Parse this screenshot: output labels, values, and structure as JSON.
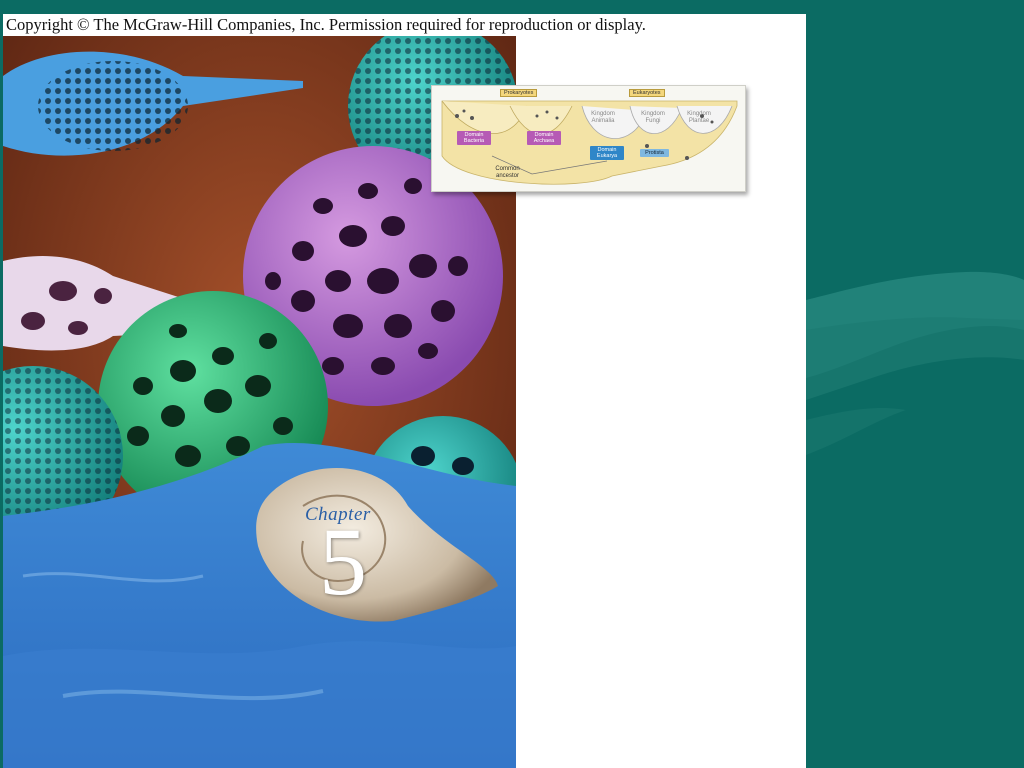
{
  "copyright": "Copyright © The McGraw-Hill Companies, Inc. Permission required for reproduction or display.",
  "cover": {
    "chapter_word": "Chapter",
    "chapter_number": "5"
  },
  "tree_diagram": {
    "prokaryotes_header": "Prokaryotes",
    "eukaryotes_header": "Eukaryotes",
    "domain_bacteria": "Domain Bacteria",
    "domain_archaea": "Domain Archaea",
    "domain_eukarya": "Domain Eukarya",
    "protista": "Protista",
    "kingdom_animalia": "Kingdom Animalia",
    "kingdom_fungi": "Kingdom Fungi",
    "kingdom_plantae": "Kingdom Plantae",
    "common_ancestor": "Common ancestor"
  },
  "colors": {
    "background_teal": "#0b6b63",
    "domain_purple": "#b65ab5",
    "domain_blue": "#2f86c8",
    "protista_blue": "#7fb8e0"
  }
}
